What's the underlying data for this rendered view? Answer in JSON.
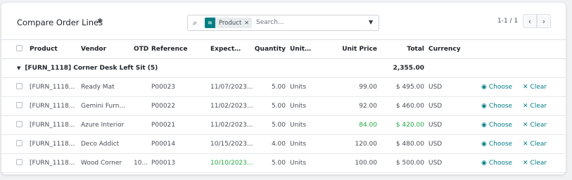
{
  "header": {
    "title": "Compare Order Lines",
    "gear_icon": "gear-icon"
  },
  "search": {
    "facet_label": "Product",
    "facet_icon": "layers-icon",
    "placeholder": "Search...",
    "magnifier_icon": "search-icon"
  },
  "pager": {
    "text": "1-1 / 1"
  },
  "columns": {
    "product": "Product",
    "vendor": "Vendor",
    "otd": "OTD",
    "reference": "Reference",
    "expected": "Expect…",
    "quantity": "Quantity",
    "unit": "Unit…",
    "unit_price": "Unit Price",
    "total": "Total",
    "currency": "Currency"
  },
  "group": {
    "label": "[FURN_1118] Corner Desk Left Sit (5)",
    "total": "2,355.00"
  },
  "actions": {
    "choose": "Choose",
    "clear": "Clear"
  },
  "rows": [
    {
      "product": "[FURN_1118...",
      "vendor": "Ready Mat",
      "otd": "",
      "reference": "P00023",
      "expected": "11/07/2023...",
      "quantity": "5.00",
      "unit": "Units",
      "unit_price": "99.00",
      "total": "$ 495.00",
      "currency": "USD"
    },
    {
      "product": "[FURN_1118...",
      "vendor": "Gemini Furn...",
      "otd": "",
      "reference": "P00022",
      "expected": "11/02/2023...",
      "quantity": "5.00",
      "unit": "Units",
      "unit_price": "92.00",
      "total": "$ 460.00",
      "currency": "USD"
    },
    {
      "product": "[FURN_1118...",
      "vendor": "Azure Interior",
      "otd": "",
      "reference": "P00021",
      "expected": "11/02/2023...",
      "quantity": "5.00",
      "unit": "Units",
      "unit_price": "84.00",
      "total": "$ 420.00",
      "currency": "USD"
    },
    {
      "product": "[FURN_1118...",
      "vendor": "Deco Addict",
      "otd": "",
      "reference": "P00014",
      "expected": "10/15/2023...",
      "quantity": "4.00",
      "unit": "Units",
      "unit_price": "120.00",
      "total": "$ 480.00",
      "currency": "USD"
    },
    {
      "product": "[FURN_1118...",
      "vendor": "Wood Corner",
      "otd": "10...",
      "reference": "P00013",
      "expected": "10/10/2023...",
      "quantity": "5.00",
      "unit": "Units",
      "unit_price": "100.00",
      "total": "$ 500.00",
      "currency": "USD"
    }
  ],
  "colors": {
    "accent": "#017e84",
    "highlight_green": "#28a745"
  }
}
